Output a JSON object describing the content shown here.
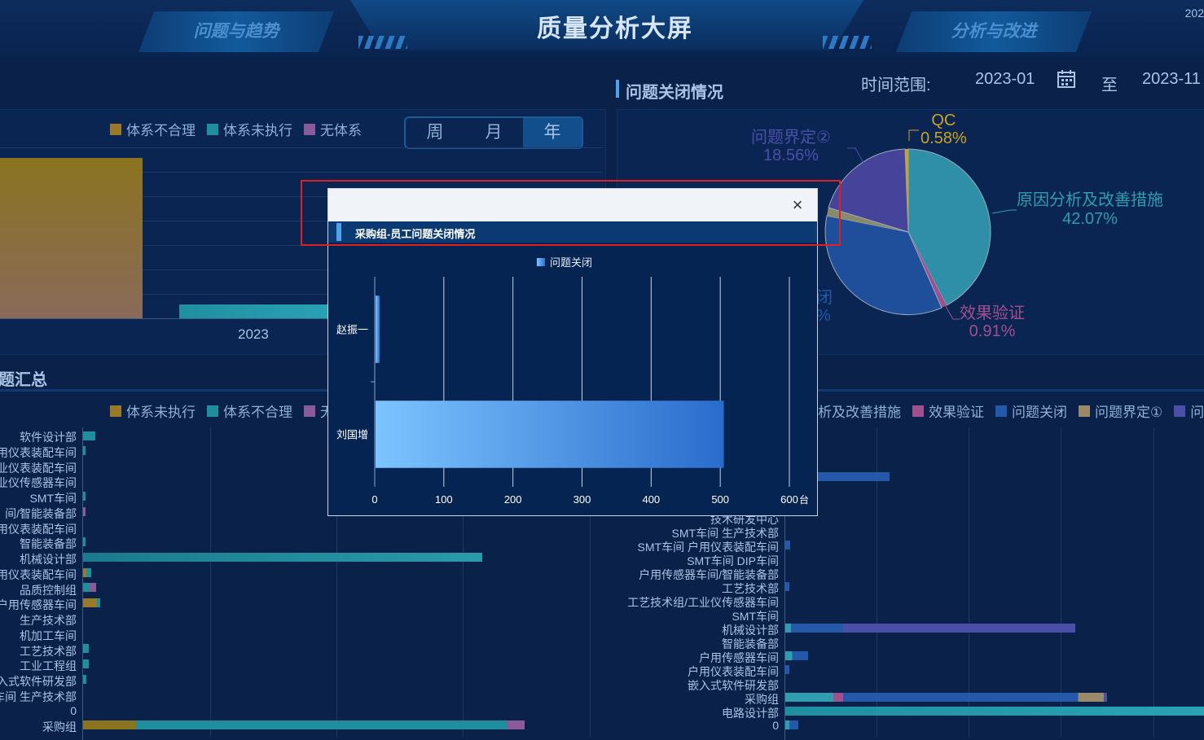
{
  "header": {
    "title": "质量分析大屏",
    "tab_left": "问题与趋势",
    "tab_right": "分析与改进",
    "corner_text": "202"
  },
  "left_top": {
    "legend": [
      {
        "label": "体系不合理",
        "color": "#9a7a2a"
      },
      {
        "label": "体系未执行",
        "color": "#1f8fa0"
      },
      {
        "label": "无体系",
        "color": "#8a5a9a"
      }
    ],
    "period": {
      "week": "周",
      "month": "月",
      "year": "年",
      "selected": "年"
    },
    "x_label": "2023"
  },
  "left_bottom": {
    "title": "题汇总",
    "legend": [
      {
        "label": "体系未执行",
        "color": "#9a7a2a"
      },
      {
        "label": "体系不合理",
        "color": "#1f8fa0"
      },
      {
        "label": "无",
        "color": "#8a5a9a"
      }
    ],
    "rows": [
      "软件设计部",
      "用仪表装配车间",
      "业仪表装配车间",
      "业仪传感器车间",
      "SMT车间",
      "间/智能装备部",
      "用仪表装配车间",
      "智能装备部",
      "机械设计部",
      "用仪表装配车间",
      "品质控制组",
      "户用传感器车间",
      "生产技术部",
      "机加工车间",
      "工艺技术部",
      "工业工程组",
      "入式软件研发部",
      "车间 生产技术部",
      "0",
      "采购组"
    ]
  },
  "right_top": {
    "title": "问题关闭情况",
    "time_range_label": "时间范围:",
    "start": "2023-01",
    "to": "至",
    "end": "2023-11",
    "pie_labels": [
      {
        "name": "QC",
        "value": "0.58%",
        "color": "#c9a227"
      },
      {
        "name": "问题界定②",
        "value": "18.56%",
        "color": "#4a4fa8"
      },
      {
        "name": "问题界定①",
        "value": "",
        "color": "#6b7aa0"
      },
      {
        "name": "原因分析及改善措施",
        "value": "42.07%",
        "color": "#2f9cb0"
      },
      {
        "name": "效果验证",
        "value": "0.91%",
        "color": "#a0508e"
      },
      {
        "name": "闭",
        "value": "%",
        "color": "#2458a8"
      }
    ]
  },
  "right_bottom": {
    "legend": [
      {
        "label": "析及改善措施",
        "color": "#2f9cb0"
      },
      {
        "label": "效果验证",
        "color": "#a0508e"
      },
      {
        "label": "问题关闭",
        "color": "#2458a8"
      },
      {
        "label": "问题界定①",
        "color": "#9a8a6a"
      },
      {
        "label": "问",
        "color": "#4a4fa8"
      }
    ],
    "rows": [
      "技术研发中心",
      "SMT车间 生产技术部",
      "SMT车间 户用仪表装配车间",
      "SMT车间 DIP车间",
      "户用传感器车间/智能装备部",
      "工艺技术部",
      "工艺技术组/工业仪传感器车间",
      "SMT车间",
      "机械设计部",
      "智能装备部",
      "户用传感器车间",
      "户用仪表装配车间",
      "嵌入式软件研发部",
      "采购组",
      "电路设计部",
      "0"
    ]
  },
  "dialog": {
    "close_icon": "×",
    "subtitle": "采购组-员工问题关闭情况",
    "legend": "问题关闭",
    "unit": "台"
  },
  "chart_data": {
    "type": "bar",
    "orientation": "horizontal",
    "title": "采购组-员工问题关闭情况",
    "categories": [
      "赵振一",
      "刘国增"
    ],
    "series": [
      {
        "name": "问题关闭",
        "values": [
          6,
          504
        ]
      }
    ],
    "xlim": [
      0,
      600
    ],
    "xticks": [
      "0",
      "100",
      "200",
      "300",
      "400",
      "500",
      "600"
    ],
    "xunit": "台",
    "grid": true,
    "legend_position": "top-center"
  }
}
